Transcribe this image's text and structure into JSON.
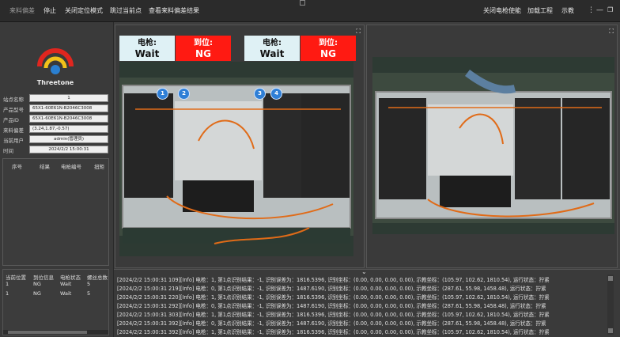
{
  "topbar": {
    "items": [
      "来料偏差",
      "停止",
      "关闭定位模式",
      "跳过当前点",
      "查看来料偏差结果"
    ],
    "right_items": [
      "关闭电枪使能",
      "加载工程",
      "示教"
    ],
    "more_icon": "⋮",
    "minimize_icon": "—",
    "restore_icon": "❐"
  },
  "logo": {
    "text": "Threetone"
  },
  "info": [
    {
      "label": "站点名称",
      "value": "1"
    },
    {
      "label": "产品型号",
      "value": "65X1-60E61N-B2046C3008"
    },
    {
      "label": "产品ID",
      "value": "65X1-60E61N-B2046C3008"
    },
    {
      "label": "来料偏差",
      "value": "(3.24,1.87,-0.57)"
    },
    {
      "label": "当前用户",
      "value": "admin(管理员)"
    },
    {
      "label": "时间",
      "value": "2024/2/2 15:00:31"
    }
  ],
  "table1": {
    "headers": [
      "序号",
      "结果",
      "电枪编号",
      "扭矩"
    ]
  },
  "table2": {
    "headers": [
      "当前位置",
      "到位信息",
      "电枪状态",
      "螺丝总数"
    ],
    "rows": [
      [
        "1",
        "NG",
        "Wait",
        "5"
      ],
      [
        "1",
        "NG",
        "Wait",
        "5"
      ]
    ]
  },
  "camera_left": {
    "status": [
      {
        "line1": "电枪:",
        "line2": "Wait",
        "type": "wait"
      },
      {
        "line1": "到位:",
        "line2": "NG",
        "type": "ng"
      },
      {
        "line1": "电枪:",
        "line2": "Wait",
        "type": "wait"
      },
      {
        "line1": "到位:",
        "line2": "NG",
        "type": "ng"
      }
    ],
    "markers": [
      "1",
      "2",
      "3",
      "4"
    ]
  },
  "log": {
    "chevron": "⌄",
    "lines": [
      "[2024/2/2 15:00:31 109][Info]  电枪：1, 第1点识别结果：-1, 识别误差为：1816.5396, 识别坐标：(0.00, 0.00, 0.00, 0.00), 示教坐标：(105.97, 102.62, 1810.54), 运行状态：拧紧",
      "[2024/2/2 15:00:31 219][Info]  电枪：0, 第1点识别结果：-1, 识别误差为：1487.6190, 识别坐标：(0.00, 0.00, 0.00, 0.00), 示教坐标：(287.61, 55.98, 1458.48), 运行状态：拧紧",
      "[2024/2/2 15:00:31 220][Info]  电枪：1, 第1点识别结果：-1, 识别误差为：1816.5396, 识别坐标：(0.00, 0.00, 0.00, 0.00), 示教坐标：(105.97, 102.62, 1810.54), 运行状态：拧紧",
      "[2024/2/2 15:00:31 292][Info]  电枪：0, 第1点识别结果：-1, 识别误差为：1487.6190, 识别坐标：(0.00, 0.00, 0.00, 0.00), 示教坐标：(287.61, 55.98, 1458.48), 运行状态：拧紧",
      "[2024/2/2 15:00:31 303][Info]  电枪：1, 第1点识别结果：-1, 识别误差为：1816.5396, 识别坐标：(0.00, 0.00, 0.00, 0.00), 示教坐标：(105.97, 102.62, 1810.54), 运行状态：拧紧",
      "[2024/2/2 15:00:31 392][Info]  电枪：0, 第1点识别结果：-1, 识别误差为：1487.6190, 识别坐标：(0.00, 0.00, 0.00, 0.00), 示教坐标：(287.61, 55.98, 1458.48), 运行状态：拧紧",
      "[2024/2/2 15:00:31 392][Info]  电枪：1, 第1点识别结果：-1, 识别误差为：1816.5396, 识别坐标：(0.00, 0.00, 0.00, 0.00), 示教坐标：(105.97, 102.62, 1810.54), 运行状态：拧紧"
    ]
  },
  "colors": {
    "ng": "#ff1a12",
    "wait": "#dff1f5",
    "marker": "#2f7fd6",
    "logo_red": "#e0261f",
    "logo_yellow": "#f2c21a",
    "logo_blue": "#2a7fd0"
  }
}
